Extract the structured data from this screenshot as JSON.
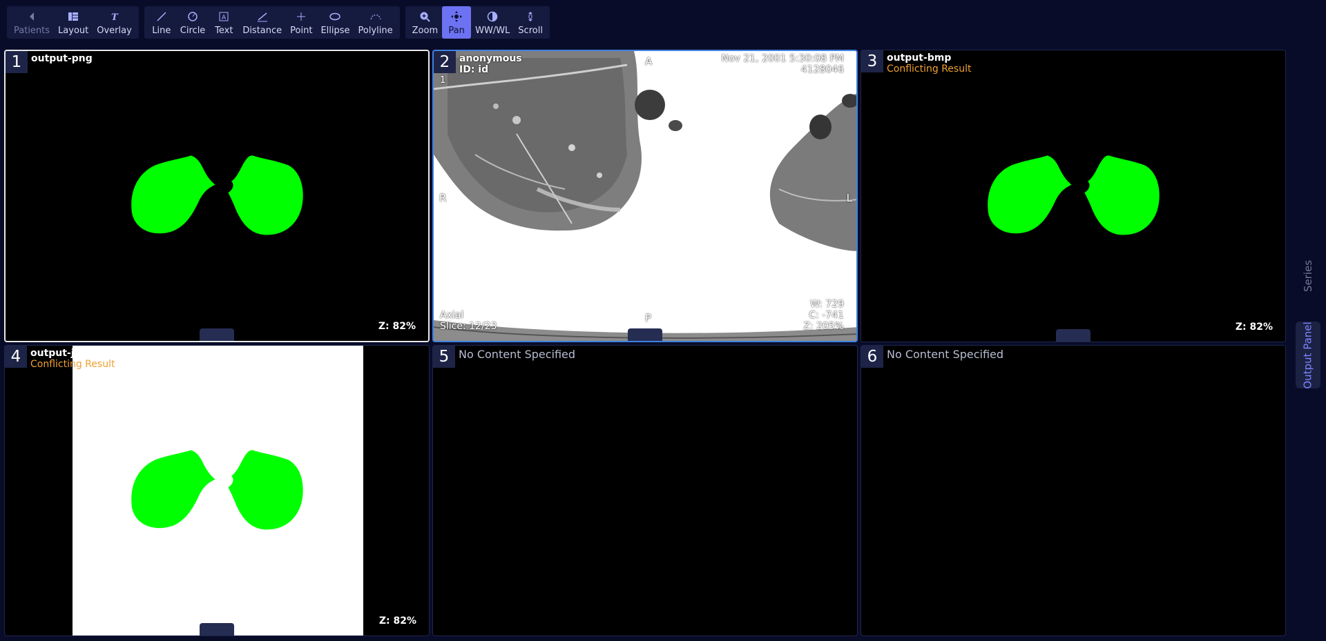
{
  "toolbar": {
    "nav": [
      {
        "label": "Patients",
        "icon": "chevron-left-icon",
        "state": "disabled"
      },
      {
        "label": "Layout",
        "icon": "layout-grid-icon",
        "state": "normal"
      },
      {
        "label": "Overlay",
        "icon": "text-overlay-icon",
        "state": "normal"
      }
    ],
    "annotate": [
      {
        "label": "Line",
        "icon": "line-icon"
      },
      {
        "label": "Circle",
        "icon": "circle-icon"
      },
      {
        "label": "Text",
        "icon": "text-box-icon"
      },
      {
        "label": "Distance",
        "icon": "distance-icon"
      },
      {
        "label": "Point",
        "icon": "point-icon"
      },
      {
        "label": "Ellipse",
        "icon": "ellipse-icon"
      },
      {
        "label": "Polyline",
        "icon": "polyline-icon"
      }
    ],
    "view": [
      {
        "label": "Zoom",
        "icon": "zoom-icon",
        "state": "normal"
      },
      {
        "label": "Pan",
        "icon": "pan-icon",
        "state": "active"
      },
      {
        "label": "WW/WL",
        "icon": "contrast-icon",
        "state": "normal"
      },
      {
        "label": "Scroll",
        "icon": "scroll-icon",
        "state": "normal"
      }
    ]
  },
  "viewports": [
    {
      "number": "1",
      "title": "output-png",
      "zoom": "Z: 82%"
    },
    {
      "number": "2",
      "patient_name": "anonymous",
      "patient_id": "ID: id",
      "image_index": "1",
      "datetime": "Nov 21, 2001 5:30:08 PM",
      "accession": "4128046",
      "orient_top": "A",
      "orient_left": "R",
      "orient_right": "L",
      "orient_bottom": "P",
      "plane": "Axial",
      "slice": "Slice: 12/23",
      "window": "W: 729",
      "center": "C: -741",
      "zoom": "Z: 205%"
    },
    {
      "number": "3",
      "title": "output-bmp",
      "status": "Conflicting Result",
      "zoom": "Z: 82%"
    },
    {
      "number": "4",
      "title": "output-jpeg",
      "status": "Conflicting Result",
      "zoom": "Z: 82%"
    },
    {
      "number": "5",
      "empty": "No Content Specified"
    },
    {
      "number": "6",
      "empty": "No Content Specified"
    }
  ],
  "side_tabs": {
    "series": "Series",
    "output": "Output Panel"
  },
  "colors": {
    "background": "#090c29",
    "accent": "#6d72f2",
    "segmentation": "#00ff00",
    "conflict": "#f0a030",
    "selected_blue": "#3f82e0"
  }
}
